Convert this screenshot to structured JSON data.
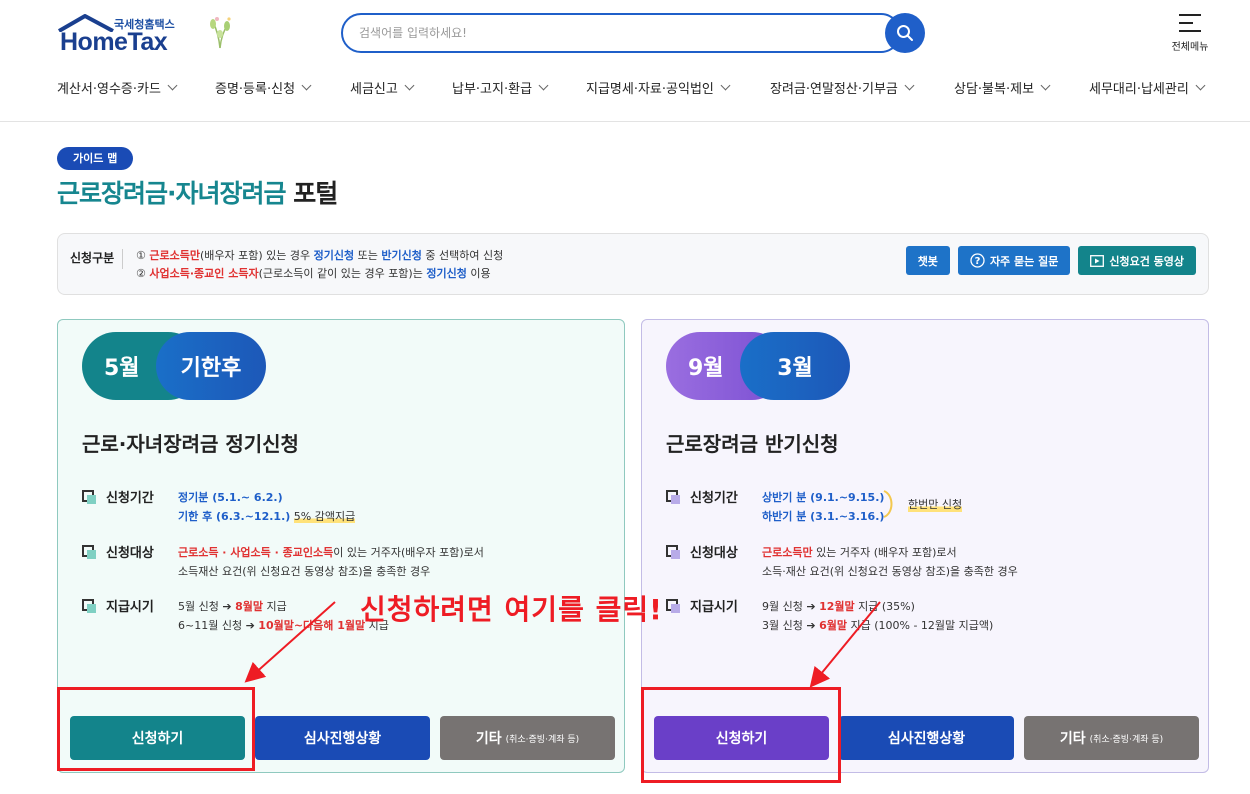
{
  "header": {
    "logo_small": "국세청홈택스",
    "logo_big": "HomeTax",
    "search_placeholder": "검색어를 입력하세요!",
    "all_menu_label": "전체메뉴",
    "nav": [
      "계산서·영수증·카드",
      "증명·등록·신청",
      "세금신고",
      "납부·고지·환급",
      "지급명세·자료·공익법인",
      "장려금·연말정산·기부금",
      "상담·불복·제보",
      "세무대리·납세관리"
    ]
  },
  "title": {
    "badge": "가이드 맵",
    "part_teal": "근로장려금·자녀장려금",
    "part_dark": "포털"
  },
  "info": {
    "label": "신청구분",
    "line1": {
      "num": "①",
      "red": "근로소득만",
      "t1": "(배우자 포함) 있는 경우",
      "blue1": "정기신청",
      "t2": "또는",
      "blue2": "반기신청",
      "t3": "중 선택하여 신청"
    },
    "line2": {
      "num": "②",
      "red": "사업소득·종교인 소득자",
      "t1": "(근로소득이 같이 있는 경우 포함)는",
      "blue1": "정기신청",
      "t2": "이용"
    },
    "buttons": {
      "chatbot": "챗봇",
      "faq": "자주 묻는 질문",
      "video": "신청요건 동영상"
    }
  },
  "card_left": {
    "pill_a": "5월",
    "pill_b": "기한후",
    "title": "근로·자녀장려금 정기신청",
    "period_label": "신청기간",
    "period_1": "정기분 (5.1.~ 6.2.)",
    "period_2": "기한 후 (6.3.~12.1.)",
    "period_2_note": "5% 감액지급",
    "target_label": "신청대상",
    "target_red": "근로소득 · 사업소득 · 종교인소득",
    "target_t1": "이 있는 거주자(배우자 포함)로서",
    "target_t2": "소득재산 요건(위 신청요건 동영상 참조)을 충족한 경우",
    "pay_label": "지급시기",
    "pay_1a": "5월 신청 ➔",
    "pay_1red": "8월말",
    "pay_1b": "지급",
    "pay_2a": "6~11월 신청 ➔",
    "pay_2red": "10월말~다음해 1월말",
    "pay_2b": "지급",
    "btn_apply": "신청하기",
    "btn_status": "심사진행상황",
    "btn_etc": "기타",
    "btn_etc_small": "(취소·증빙·계좌 등)"
  },
  "card_right": {
    "pill_a": "9월",
    "pill_b": "3월",
    "title": "근로장려금 반기신청",
    "period_label": "신청기간",
    "period_1": "상반기 분 (9.1.~9.15.)",
    "period_2": "하반기 분 (3.1.~3.16.)",
    "period_note": "한번만 신청",
    "target_label": "신청대상",
    "target_red": "근로소득만",
    "target_t1": "있는 거주자 (배우자 포함)로서",
    "target_t2": "소득·재산 요건(위 신청요건 동영상 참조)을 충족한 경우",
    "pay_label": "지급시기",
    "pay_1a": "9월 신청 ➔",
    "pay_1red": "12월말",
    "pay_1b": "지급 (35%)",
    "pay_2a": "3월 신청 ➔",
    "pay_2red": "6월말",
    "pay_2b": "지급 (100% - 12월말 지급액)",
    "btn_apply": "신청하기",
    "btn_status": "심사진행상황",
    "btn_etc": "기타",
    "btn_etc_small": "(취소·증빙·계좌 등)"
  },
  "annotation": {
    "text": "신청하려면 여기를 클릭!"
  },
  "colors": {
    "teal": "#13848b",
    "navy": "#1a4bb5",
    "purple": "#6a3fc8",
    "annotation_red": "#ee1c24"
  }
}
